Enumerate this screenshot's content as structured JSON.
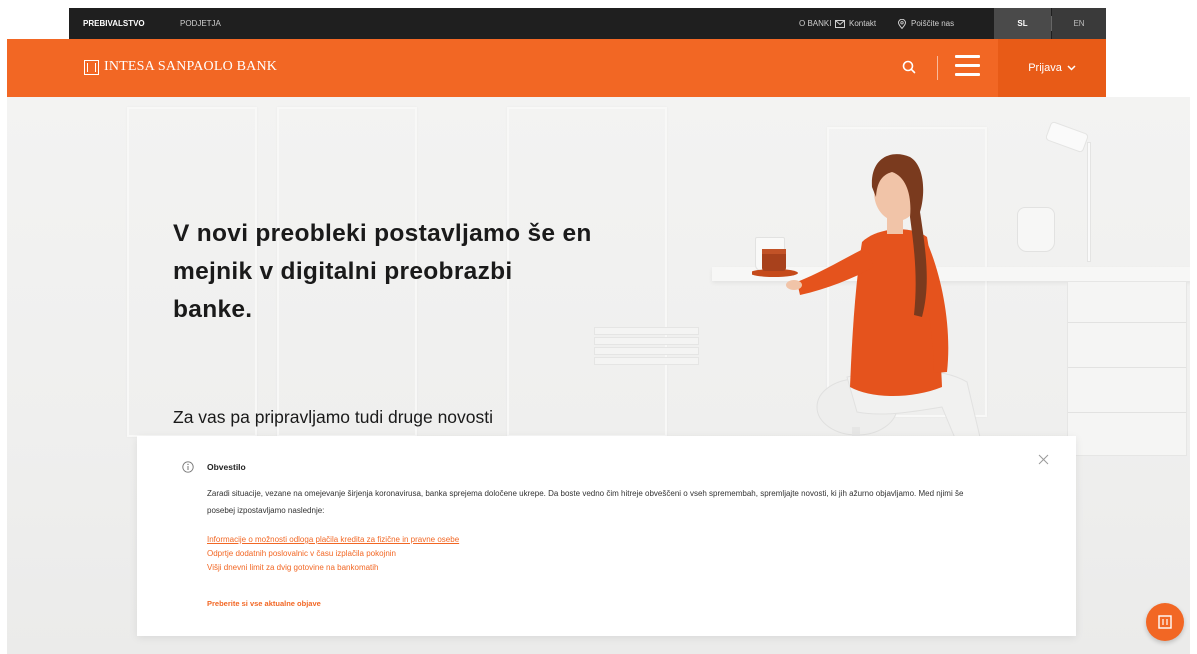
{
  "topbar": {
    "segment_personal": "PREBIVALSTVO",
    "segment_business": "PODJETJA",
    "about": "O BANKI",
    "contact": "Kontakt",
    "find_us": "Poiščite nas",
    "lang_sl": "SL",
    "lang_en": "EN"
  },
  "header": {
    "logo_text": "INTESA SANPAOLO BANK",
    "login_label": "Prijava"
  },
  "hero": {
    "title": "V novi preobleki postavljamo še en mejnik v digitalni preobrazbi banke.",
    "subtitle": "Za vas pa pripravljamo tudi druge novosti"
  },
  "notice": {
    "title": "Obvestilo",
    "body": "Zaradi situacije, vezane na omejevanje širjenja koronavirusa, banka sprejema določene ukrepe. Da boste vedno čim hitreje obveščeni o vseh spremembah, spremljajte novosti, ki jih ažurno objavljamo. Med njimi še posebej izpostavljamo naslednje:",
    "links": [
      "Informacije o možnosti odloga plačila kredita za fizične in pravne osebe",
      "Odprtje dodatnih poslovalnic v času izplačila pokojnin",
      "Višji dnevni limit za dvig gotovine na bankomatih"
    ],
    "more_label": "Preberite si vse aktualne objave"
  },
  "colors": {
    "brand_orange": "#f26724",
    "topbar_bg": "#1f1f1f"
  }
}
